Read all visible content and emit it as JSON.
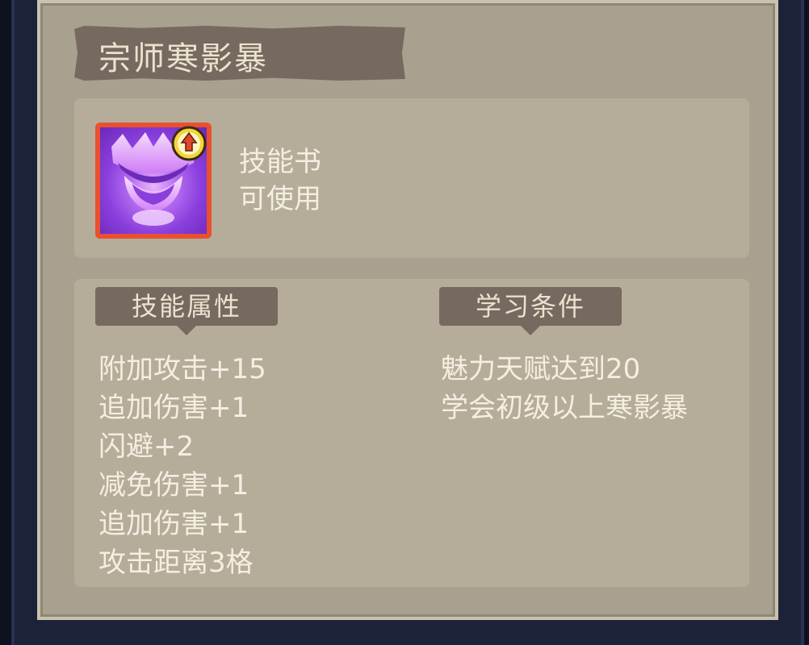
{
  "title": "宗师寒影暴",
  "item": {
    "type": "技能书",
    "status": "可使用",
    "icon": "purple-shadow-claw-icon",
    "badge_icon": "upgrade-arrow-badge-icon"
  },
  "sections": {
    "attributes": {
      "label": "技能属性",
      "items": [
        "附加攻击+15",
        "追加伤害+1",
        "闪避+2",
        "减免伤害+1",
        "追加伤害+1",
        "攻击距离3格"
      ]
    },
    "requirements": {
      "label": "学习条件",
      "items": [
        "魅力天赋达到20",
        "学会初级以上寒影暴"
      ]
    }
  },
  "colors": {
    "panel": "#a8a18f",
    "banner": "#76695f",
    "text": "#f4efe2",
    "icon_border": "#e9502f"
  }
}
